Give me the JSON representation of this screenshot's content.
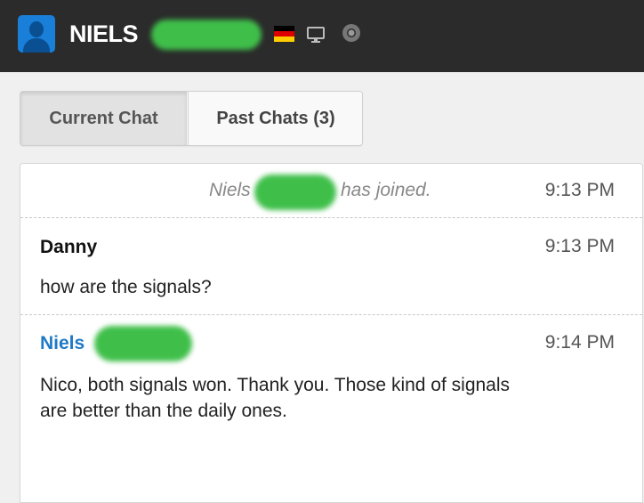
{
  "header": {
    "visitor_name": "NIELS",
    "avatar_icon": "user-silhouette-icon",
    "flag_icon": "germany-flag-icon",
    "device_icon": "desktop-monitor-icon",
    "browser_icon": "chrome-browser-icon",
    "background_color": "#2b2b2b"
  },
  "tabs": [
    {
      "label": "Current Chat",
      "active": true
    },
    {
      "label": "Past Chats (3)",
      "active": false
    }
  ],
  "chat": {
    "messages": [
      {
        "type": "system",
        "text_prefix": "Niels",
        "text_suffix": "has joined.",
        "time": "9:13 PM"
      },
      {
        "type": "message",
        "sender": "Danny",
        "time": "9:13 PM",
        "text": "how are the signals?"
      },
      {
        "type": "message",
        "sender": "Niels",
        "time": "9:14 PM",
        "text_line1": "Nico, both signals won. Thank you. Those kind of signals",
        "text_line2": "are better than the daily ones."
      }
    ],
    "agent_name_color": "#1f7ac7",
    "redaction_color": "#3fbf4a"
  }
}
